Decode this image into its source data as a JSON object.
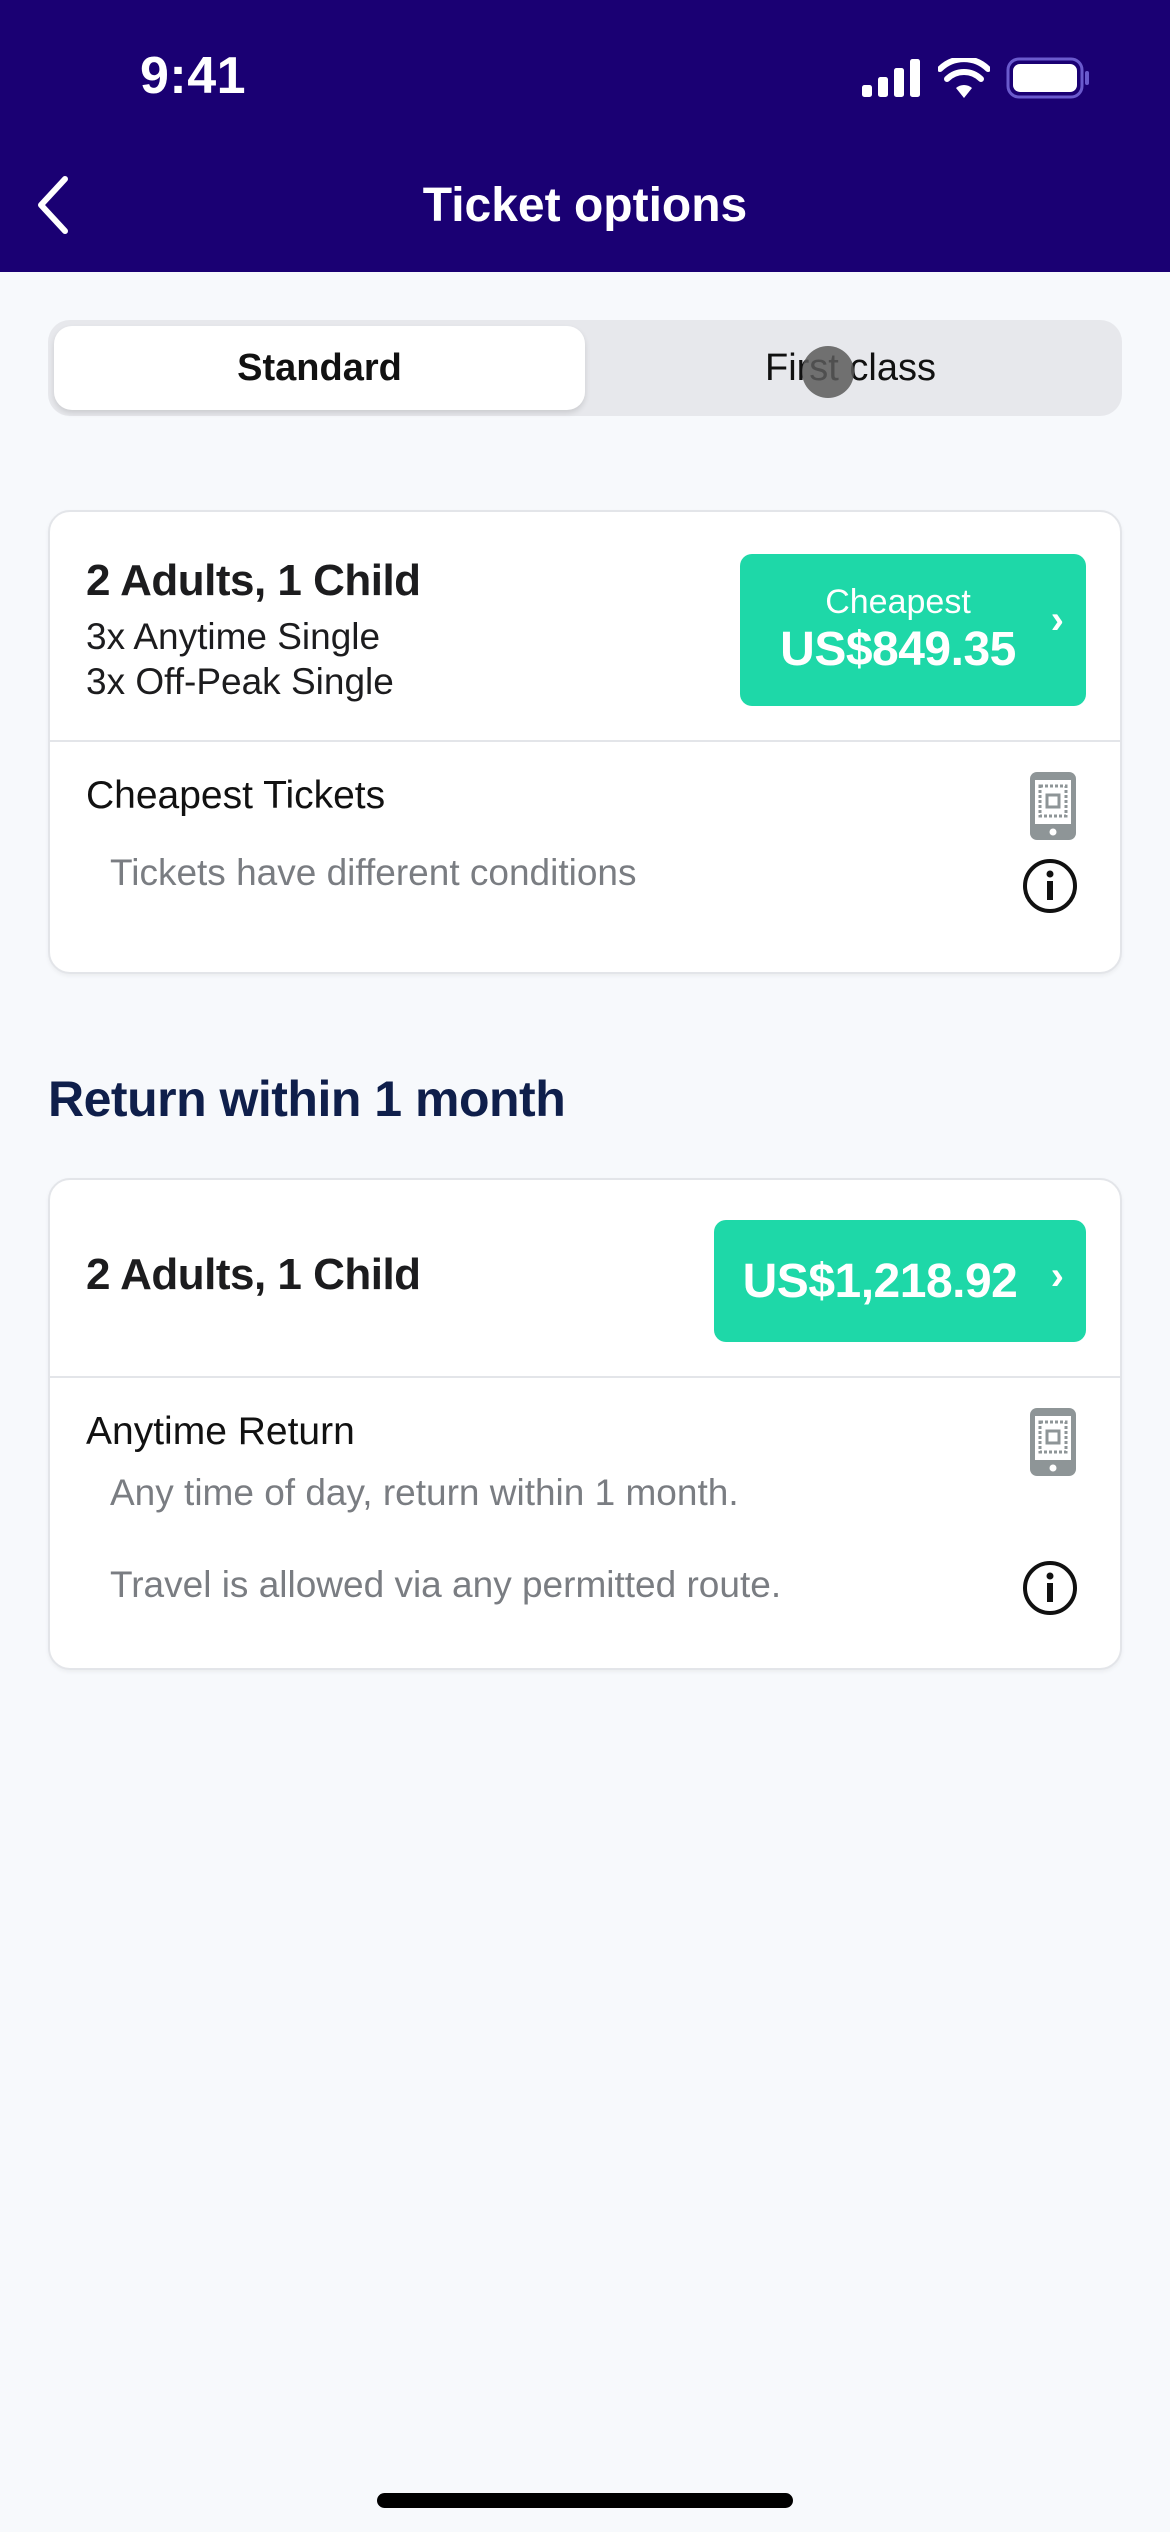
{
  "status_bar": {
    "time": "9:41",
    "icons": [
      "cellular-signal-icon",
      "wifi-icon",
      "battery-icon"
    ]
  },
  "nav": {
    "title": "Ticket options",
    "back_icon": "chevron-left-icon"
  },
  "class_toggle": {
    "options": [
      {
        "label": "Standard",
        "selected": true
      },
      {
        "label": "First class",
        "selected": false
      }
    ]
  },
  "cheapest_card": {
    "passengers": "2 Adults, 1 Child",
    "lines": [
      "3x Anytime Single",
      "3x Off-Peak Single"
    ],
    "price_label": "Cheapest",
    "price": "US$849.35",
    "chevron": "›",
    "ticket_name": "Cheapest Tickets",
    "ticket_desc": "Tickets have different conditions",
    "ticket_type_icon": "mobile-ticket-icon",
    "info_icon": "info-icon"
  },
  "return_section": {
    "title": "Return within 1 month",
    "card": {
      "passengers": "2 Adults, 1 Child",
      "price": "US$1,218.92",
      "chevron": "›",
      "ticket_name": "Anytime Return",
      "ticket_desc_lines": [
        "Any time of day, return within 1 month.",
        "Travel is allowed via any permitted route."
      ],
      "ticket_type_icon": "mobile-ticket-icon",
      "info_icon": "info-icon"
    }
  },
  "colors": {
    "header_bg": "#1a0073",
    "accent_green": "#1ed8a8",
    "section_title": "#0f1f4b",
    "page_bg": "#f7f9fc"
  }
}
